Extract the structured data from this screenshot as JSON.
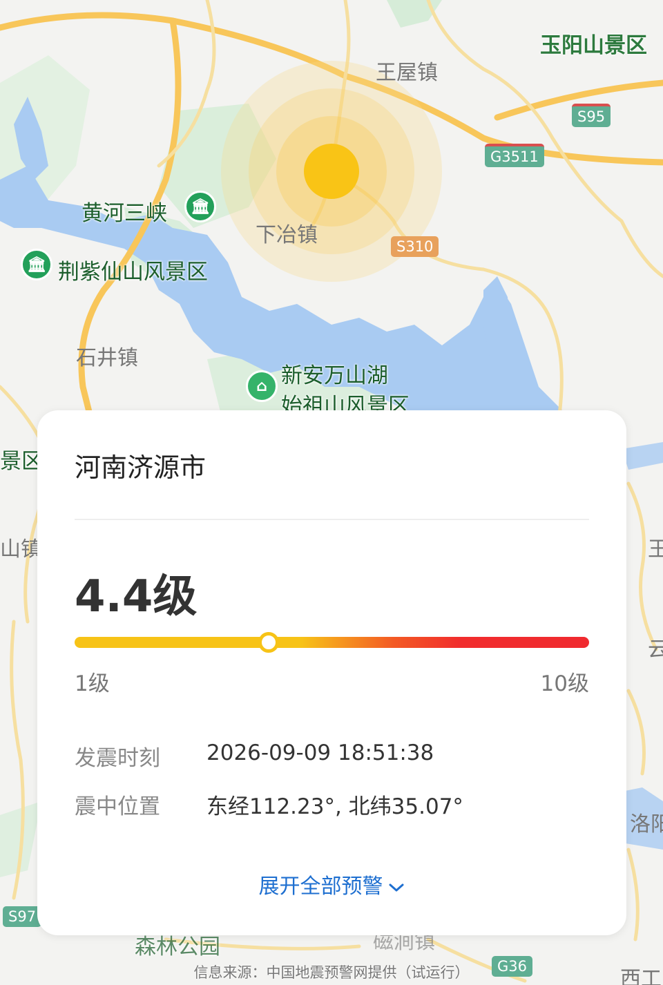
{
  "map": {
    "towns": {
      "wangwu": "王屋镇",
      "xiaye": "下冶镇",
      "shijing": "石井镇",
      "edge_shan": "山镇",
      "edge_wang": "王",
      "edge_yun": "云",
      "edge_luo": "洛阳",
      "edge_ci": "磁涧镇",
      "edge_xi": "西工"
    },
    "scenic": {
      "yuyang": "玉阳山景区",
      "huanghe": "黄河三峡",
      "jingzi": "荆紫仙山风景区",
      "xinan_line1": "新安万山湖",
      "xinan_line2": "始祖山风景区",
      "edge_jing": "景区",
      "senlin": "森林公园"
    },
    "roads": {
      "s95": "S95",
      "g3511": "G3511",
      "s310": "S310",
      "s97": "S97",
      "g36": "G36"
    },
    "epicenter_color": "#f9c416"
  },
  "card": {
    "location": "河南济源市",
    "magnitude": "4.4级",
    "magnitude_value": 4.4,
    "scale_min_label": "1级",
    "scale_max_label": "10级",
    "scale_min": 1,
    "scale_max": 10,
    "time_label": "发震时刻",
    "time_value": "2026-09-09 18:51:38",
    "pos_label": "震中位置",
    "pos_value": "东经112.23°, 北纬35.07°",
    "expand_label": "展开全部预警"
  },
  "footer": {
    "source": "信息来源：中国地震预警网提供（试运行）"
  },
  "colors": {
    "accent": "#1e6fd0",
    "scale_start": "#f7c317",
    "scale_end": "#f02a2f"
  }
}
